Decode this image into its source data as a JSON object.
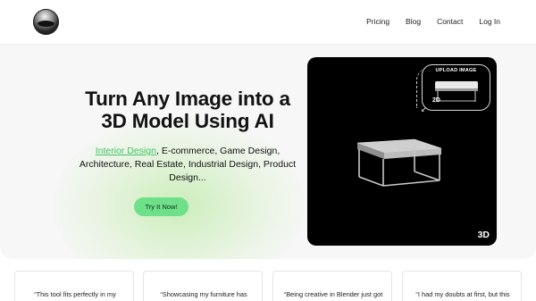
{
  "header": {
    "nav": [
      "Pricing",
      "Blog",
      "Contact",
      "Log In"
    ]
  },
  "hero": {
    "headline_line1": "Turn Any Image into a",
    "headline_line2": "3D Model Using AI",
    "sub_highlight": "Interior Design",
    "sub_line1_rest": ", E-commerce, Game Design,",
    "sub_line2": "Architecture, Real Estate, Industrial Design, Product",
    "sub_line3": "Design...",
    "cta_label": "Try It Now!"
  },
  "viewer": {
    "upload_label": "UPLOAD IMAGE",
    "label_2d": "2D",
    "label_3d": "3D"
  },
  "testimonials": [
    "“This tool fits perfectly in my",
    "“Showcasing my furniture has",
    "“Being creative in Blender just got",
    "“I had my doubts at first, but this"
  ],
  "colors": {
    "accent_green": "#6fe08a",
    "highlight_green": "#3fc468",
    "viewer_bg": "#000000"
  }
}
